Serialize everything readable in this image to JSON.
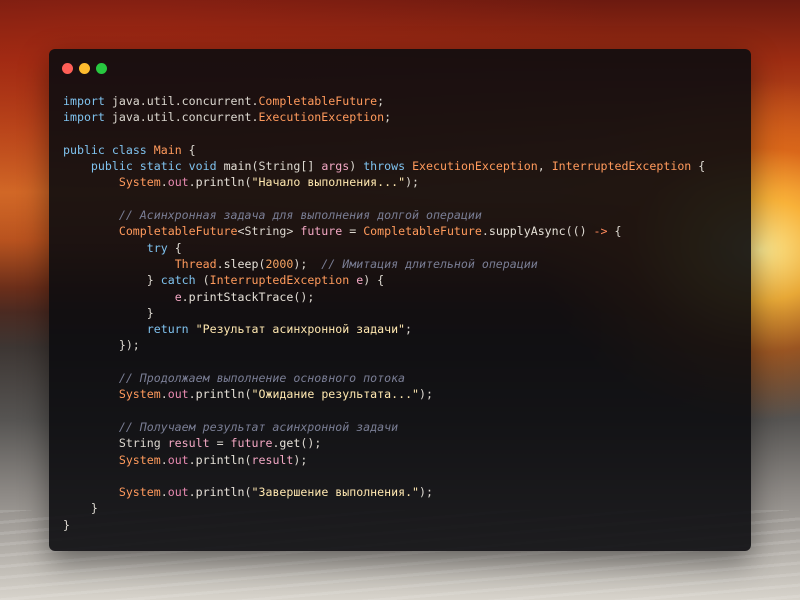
{
  "window": {
    "controls": {
      "close_color": "#ff5f57",
      "minimize_color": "#febc2e",
      "maximize_color": "#28c840"
    }
  },
  "code_lines": [
    [
      [
        "kw",
        "import"
      ],
      [
        "plain",
        " java.util.concurrent."
      ],
      [
        "type",
        "CompletableFuture"
      ],
      [
        "plain",
        ";"
      ]
    ],
    [
      [
        "kw",
        "import"
      ],
      [
        "plain",
        " java.util.concurrent."
      ],
      [
        "type",
        "ExecutionException"
      ],
      [
        "plain",
        ";"
      ]
    ],
    [],
    [
      [
        "kw",
        "public"
      ],
      [
        "plain",
        " "
      ],
      [
        "kw",
        "class"
      ],
      [
        "plain",
        " "
      ],
      [
        "type",
        "Main"
      ],
      [
        "plain",
        " {"
      ]
    ],
    [
      [
        "plain",
        "    "
      ],
      [
        "kw",
        "public"
      ],
      [
        "plain",
        " "
      ],
      [
        "kw",
        "static"
      ],
      [
        "plain",
        " "
      ],
      [
        "kw",
        "void"
      ],
      [
        "plain",
        " "
      ],
      [
        "fn",
        "main"
      ],
      [
        "plain",
        "(String[] "
      ],
      [
        "var",
        "args"
      ],
      [
        "plain",
        ") "
      ],
      [
        "kw",
        "throws"
      ],
      [
        "plain",
        " "
      ],
      [
        "type",
        "ExecutionException"
      ],
      [
        "plain",
        ", "
      ],
      [
        "type",
        "InterruptedException"
      ],
      [
        "plain",
        " {"
      ]
    ],
    [
      [
        "plain",
        "        "
      ],
      [
        "type",
        "System"
      ],
      [
        "plain",
        "."
      ],
      [
        "field",
        "out"
      ],
      [
        "plain",
        "."
      ],
      [
        "fn",
        "println"
      ],
      [
        "plain",
        "("
      ],
      [
        "str",
        "\"Начало выполнения...\""
      ],
      [
        "plain",
        ");"
      ]
    ],
    [],
    [
      [
        "plain",
        "        "
      ],
      [
        "cmt",
        "// Асинхронная задача для выполнения долгой операции"
      ]
    ],
    [
      [
        "plain",
        "        "
      ],
      [
        "type",
        "CompletableFuture"
      ],
      [
        "plain",
        "<String> "
      ],
      [
        "var",
        "future"
      ],
      [
        "plain",
        " = "
      ],
      [
        "type",
        "CompletableFuture"
      ],
      [
        "plain",
        "."
      ],
      [
        "fn",
        "supplyAsync"
      ],
      [
        "plain",
        "(() "
      ],
      [
        "arrow",
        "->"
      ],
      [
        "plain",
        " {"
      ]
    ],
    [
      [
        "plain",
        "            "
      ],
      [
        "kw",
        "try"
      ],
      [
        "plain",
        " {"
      ]
    ],
    [
      [
        "plain",
        "                "
      ],
      [
        "type",
        "Thread"
      ],
      [
        "plain",
        "."
      ],
      [
        "fn",
        "sleep"
      ],
      [
        "plain",
        "("
      ],
      [
        "num",
        "2000"
      ],
      [
        "plain",
        ");  "
      ],
      [
        "cmt",
        "// Имитация длительной операции"
      ]
    ],
    [
      [
        "plain",
        "            } "
      ],
      [
        "kw",
        "catch"
      ],
      [
        "plain",
        " ("
      ],
      [
        "type",
        "InterruptedException"
      ],
      [
        "plain",
        " "
      ],
      [
        "var",
        "e"
      ],
      [
        "plain",
        ") {"
      ]
    ],
    [
      [
        "plain",
        "                "
      ],
      [
        "var",
        "e"
      ],
      [
        "plain",
        "."
      ],
      [
        "fn",
        "printStackTrace"
      ],
      [
        "plain",
        "();"
      ]
    ],
    [
      [
        "plain",
        "            }"
      ]
    ],
    [
      [
        "plain",
        "            "
      ],
      [
        "kw",
        "return"
      ],
      [
        "plain",
        " "
      ],
      [
        "str",
        "\"Результат асинхронной задачи\""
      ],
      [
        "plain",
        ";"
      ]
    ],
    [
      [
        "plain",
        "        });"
      ]
    ],
    [],
    [
      [
        "plain",
        "        "
      ],
      [
        "cmt",
        "// Продолжаем выполнение основного потока"
      ]
    ],
    [
      [
        "plain",
        "        "
      ],
      [
        "type",
        "System"
      ],
      [
        "plain",
        "."
      ],
      [
        "field",
        "out"
      ],
      [
        "plain",
        "."
      ],
      [
        "fn",
        "println"
      ],
      [
        "plain",
        "("
      ],
      [
        "str",
        "\"Ожидание результата...\""
      ],
      [
        "plain",
        ");"
      ]
    ],
    [],
    [
      [
        "plain",
        "        "
      ],
      [
        "cmt",
        "// Получаем результат асинхронной задачи"
      ]
    ],
    [
      [
        "plain",
        "        String "
      ],
      [
        "var",
        "result"
      ],
      [
        "plain",
        " = "
      ],
      [
        "var",
        "future"
      ],
      [
        "plain",
        "."
      ],
      [
        "fn",
        "get"
      ],
      [
        "plain",
        "();"
      ]
    ],
    [
      [
        "plain",
        "        "
      ],
      [
        "type",
        "System"
      ],
      [
        "plain",
        "."
      ],
      [
        "field",
        "out"
      ],
      [
        "plain",
        "."
      ],
      [
        "fn",
        "println"
      ],
      [
        "plain",
        "("
      ],
      [
        "var",
        "result"
      ],
      [
        "plain",
        ");"
      ]
    ],
    [],
    [
      [
        "plain",
        "        "
      ],
      [
        "type",
        "System"
      ],
      [
        "plain",
        "."
      ],
      [
        "field",
        "out"
      ],
      [
        "plain",
        "."
      ],
      [
        "fn",
        "println"
      ],
      [
        "plain",
        "("
      ],
      [
        "str",
        "\"Завершение выполнения.\""
      ],
      [
        "plain",
        ");"
      ]
    ],
    [
      [
        "plain",
        "    }"
      ]
    ],
    [
      [
        "plain",
        "}"
      ]
    ]
  ]
}
